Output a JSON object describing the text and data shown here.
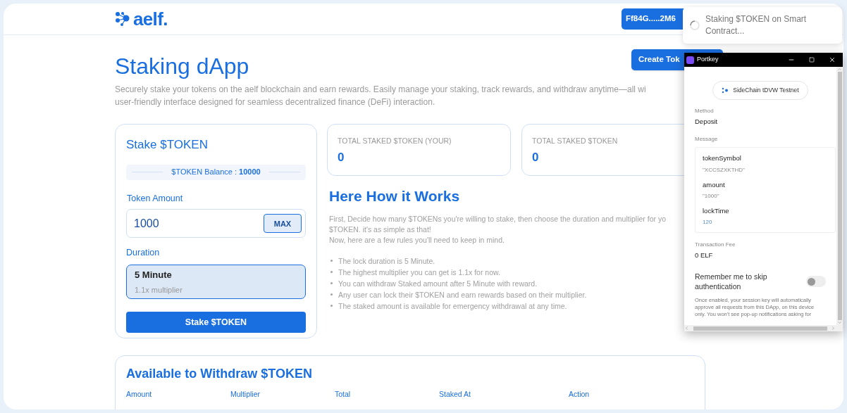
{
  "header": {
    "logo": "aelf.",
    "wallet_button": "Ff84G.....2M6"
  },
  "page": {
    "title": "Staking dApp",
    "create_button": "Create Tok",
    "description": [
      "Securely stake your tokens on the aelf blockchain and earn rewards. Easily manage your staking, track rewards, and withdraw anytime—all wi",
      "user-friendly interface designed for seamless decentralized finance (DeFi) interaction."
    ]
  },
  "stake_card": {
    "title": "Stake $TOKEN",
    "balance_label": "$TOKEN Balance : ",
    "balance_value": "10000",
    "amount_label": "Token Amount",
    "amount_value": "1000",
    "max_button": "MAX",
    "duration_label": "Duration",
    "durations": [
      {
        "name": "5 Minute",
        "multiplier": "1.1x multiplier",
        "selected": true
      }
    ],
    "stake_button": "Stake $TOKEN"
  },
  "stats": [
    {
      "label": "TOTAL STAKED $TOKEN (YOUR)",
      "value": "0"
    },
    {
      "label": "TOTAL STAKED $TOKEN",
      "value": "0"
    }
  ],
  "how_it_works": {
    "title": "Here How it Works",
    "intro": [
      "First, Decide how many $TOKENs you're willing to stake, then choose the duration and multiplier for yo",
      "$TOKEN. it's as simple as that!",
      "Now, here are a few rules you'll need to keep in mind."
    ],
    "rules": [
      "The lock duration is 5 Minute.",
      "The highest multiplier you can get is 1.1x for now.",
      "You can withdraw Staked amount after 5 Minute with reward.",
      "Any user can lock their $TOKEN and earn rewards based on their multiplier.",
      "The staked amount is available for emergency withdrawal at any time."
    ]
  },
  "withdraw_card": {
    "title": "Available to Withdraw $TOKEN",
    "columns": [
      "Amount",
      "Multiplier",
      "Total",
      "Staked At",
      "Action"
    ]
  },
  "toast": {
    "message": "Staking $TOKEN on Smart Contract..."
  },
  "portkey_window": {
    "title": "Portkey",
    "network": "SideChain tDVW Testnet",
    "method_label": "Method",
    "method": "Deposit",
    "message_label": "Message",
    "params": [
      {
        "name": "tokenSymbol",
        "value": "\"XCCSZXKTHD\"",
        "kind": "string"
      },
      {
        "name": "amount",
        "value": "\"1000\"",
        "kind": "string"
      },
      {
        "name": "lockTime",
        "value": "120",
        "kind": "number"
      }
    ],
    "fee_label": "Transaction Fee",
    "fee": "0 ELF",
    "remember_label": "Remember me to skip authentication",
    "remember_on": false,
    "notice": "Once enabled, your session key will automatically approve all requests from this DApp, on this device only. You won't see pop-up notifications asking for"
  }
}
